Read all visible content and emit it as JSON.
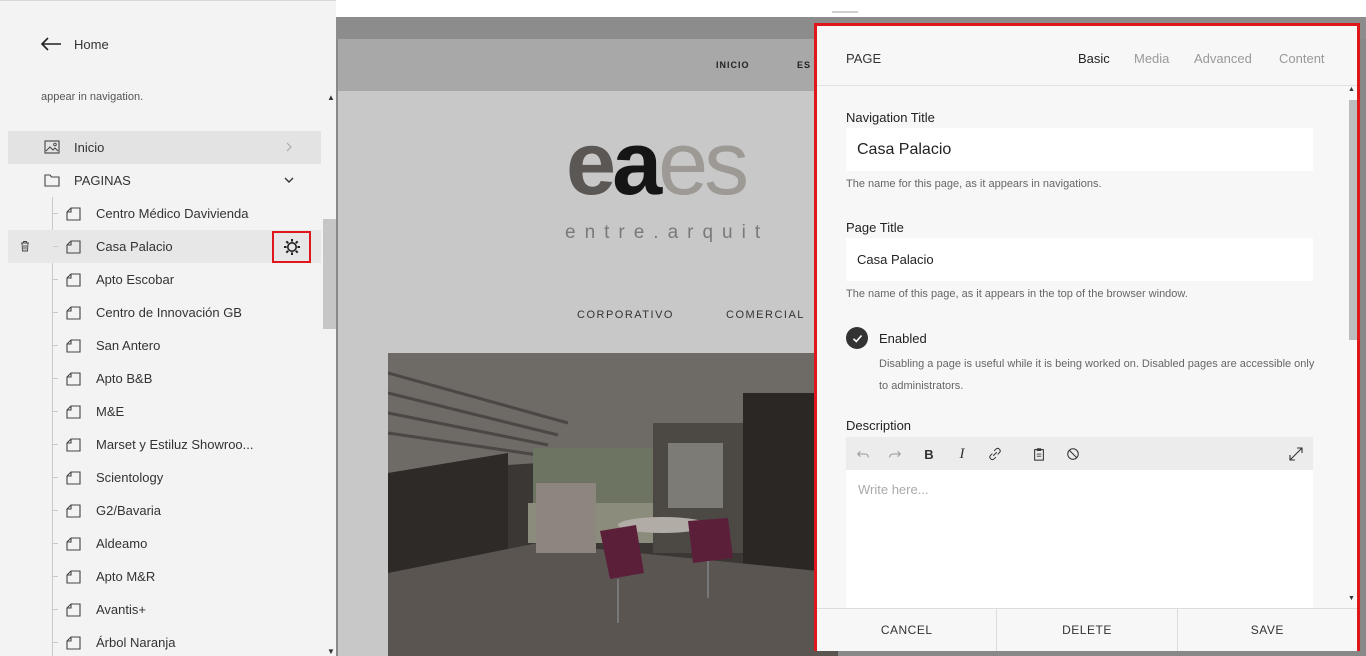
{
  "sidebar": {
    "home_label": "Home",
    "hint": "appear in navigation.",
    "nav": [
      {
        "label": "Inicio",
        "icon": "image-icon"
      },
      {
        "label": "PAGINAS",
        "icon": "folder-icon"
      }
    ],
    "pages": [
      "Centro Médico Davivienda",
      "Casa Palacio",
      "Apto Escobar",
      "Centro de Innovación GB",
      "San Antero",
      "Apto B&B",
      "M&E",
      "Marset y Estiluz Showroo...",
      "Scientology",
      "G2/Bavaria",
      "Aldeamo",
      "Apto M&R",
      "Avantis+",
      "Árbol Naranja"
    ],
    "selected_page": "Casa Palacio"
  },
  "site": {
    "nav_items": [
      "INICIO",
      "ES"
    ],
    "logo": {
      "part1": "e",
      "part2": "a",
      "part3": "es"
    },
    "tagline": "entre.arquit",
    "categories": [
      "CORPORATIVO",
      "COMERCIAL"
    ]
  },
  "panel": {
    "title": "PAGE",
    "tabs": [
      "Basic",
      "Media",
      "Advanced",
      "Content"
    ],
    "active_tab": "Basic",
    "nav_title_label": "Navigation Title",
    "nav_title_value": "Casa Palacio",
    "nav_title_help": "The name for this page, as it appears in navigations.",
    "page_title_label": "Page Title",
    "page_title_value": "Casa Palacio",
    "page_title_help": "The name of this page, as it appears in the top of the browser window.",
    "enabled_label": "Enabled",
    "enabled_help": "Disabling a page is useful while it is being worked on. Disabled pages are accessible only to administrators.",
    "description_label": "Description",
    "description_placeholder": "Write here...",
    "buttons": {
      "cancel": "CANCEL",
      "delete": "DELETE",
      "save": "SAVE"
    }
  },
  "colors": {
    "highlight_border": "#e0161d",
    "check_fill": "#333333"
  }
}
